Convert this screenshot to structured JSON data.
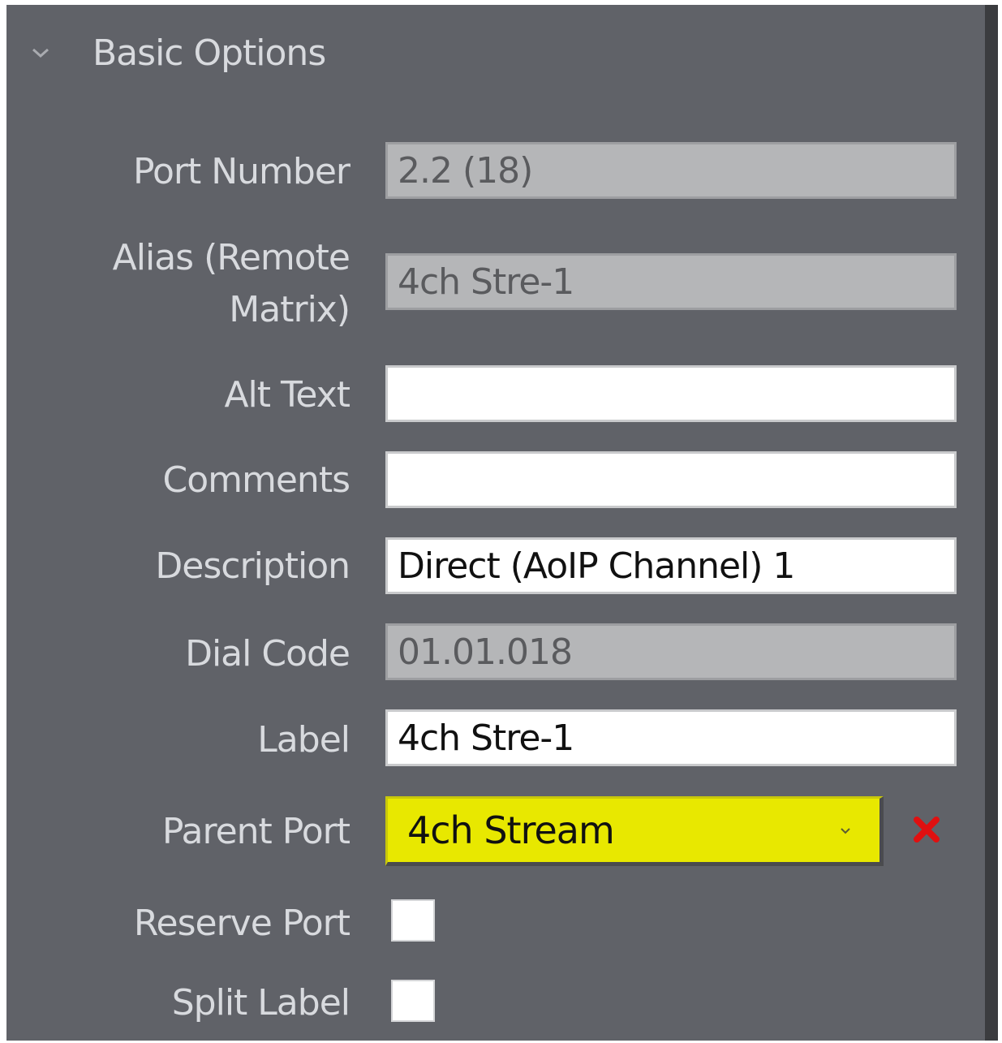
{
  "section": {
    "title": "Basic Options",
    "collapse_icon": "chevron-down-icon"
  },
  "fields": {
    "port_number": {
      "label": "Port Number",
      "value": "2.2 (18)"
    },
    "alias": {
      "label_line1": "Alias (Remote",
      "label_line2": "Matrix)",
      "value": "4ch Stre-1"
    },
    "alt_text": {
      "label": "Alt Text",
      "value": ""
    },
    "comments": {
      "label": "Comments",
      "value": ""
    },
    "description": {
      "label": "Description",
      "value": "Direct (AoIP Channel) 1"
    },
    "dial_code": {
      "label": "Dial Code",
      "value": "01.01.018"
    },
    "label": {
      "label": "Label",
      "value": "4ch Stre-1"
    },
    "parent_port": {
      "label": "Parent Port",
      "value": "4ch Stream",
      "highlight_color": "#e8e800",
      "clear_icon": "close-icon",
      "clear_color": "#e01010"
    },
    "reserve_port": {
      "label": "Reserve Port",
      "checked": false
    },
    "split_label": {
      "label": "Split Label",
      "checked": false
    }
  }
}
